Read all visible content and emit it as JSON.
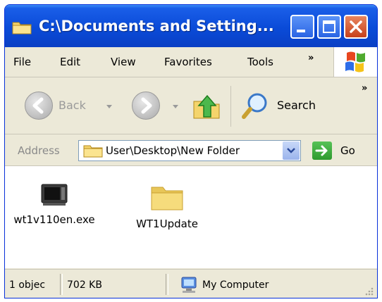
{
  "window": {
    "title": "C:\\Documents and Setting..."
  },
  "menu": {
    "items": [
      "File",
      "Edit",
      "View",
      "Favorites",
      "Tools"
    ],
    "overflow": "»"
  },
  "toolbar": {
    "back_label": "Back",
    "search_label": "Search",
    "overflow": "»"
  },
  "address": {
    "label": "Address",
    "value": "User\\Desktop\\New Folder",
    "go_label": "Go"
  },
  "files": [
    {
      "name": "wt1v110en.exe",
      "icon": "executable-icon"
    },
    {
      "name": "WT1Update",
      "icon": "folder-icon"
    }
  ],
  "status": {
    "objects": "1 objec",
    "size": "702 KB",
    "zone": "My Computer"
  },
  "colors": {
    "titlebar": "#0a4bd8",
    "chrome": "#ece9d8",
    "close_button": "#c7401b",
    "go_button": "#2e9a2e",
    "folder": "#f2d36b"
  }
}
